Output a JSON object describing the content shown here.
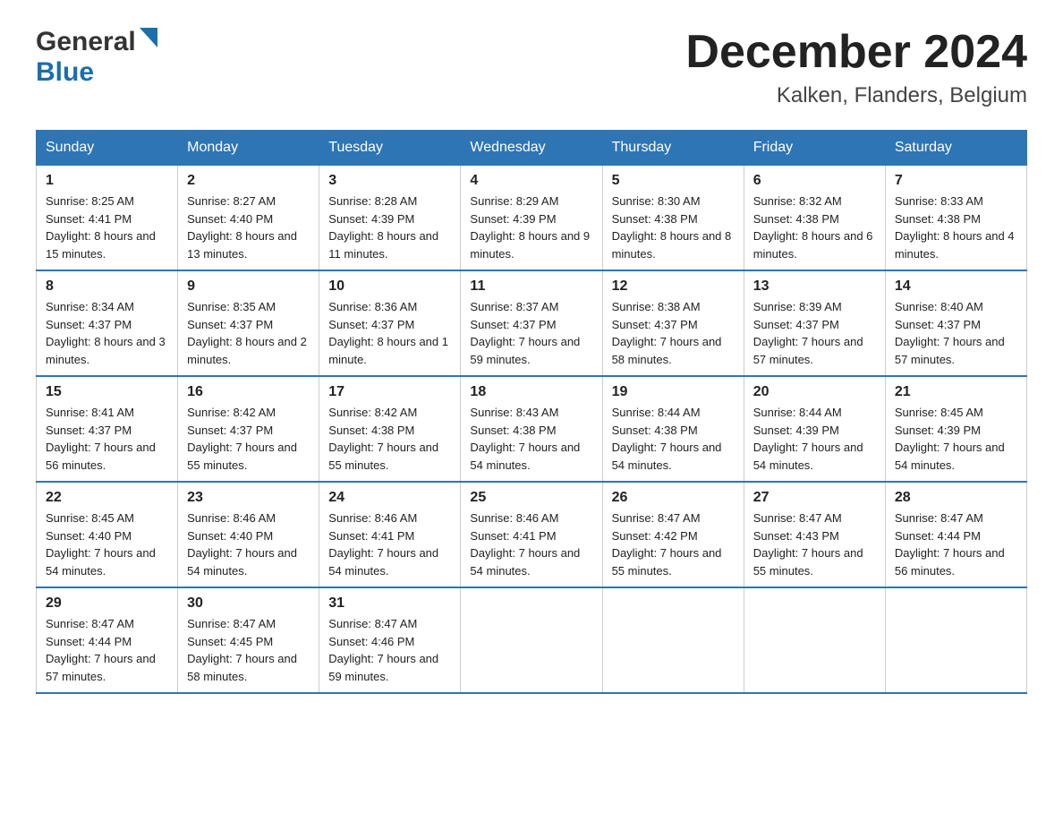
{
  "logo": {
    "general": "General",
    "blue": "Blue"
  },
  "header": {
    "month_year": "December 2024",
    "location": "Kalken, Flanders, Belgium"
  },
  "days_of_week": [
    "Sunday",
    "Monday",
    "Tuesday",
    "Wednesday",
    "Thursday",
    "Friday",
    "Saturday"
  ],
  "weeks": [
    [
      {
        "day": "1",
        "sunrise": "8:25 AM",
        "sunset": "4:41 PM",
        "daylight": "8 hours and 15 minutes."
      },
      {
        "day": "2",
        "sunrise": "8:27 AM",
        "sunset": "4:40 PM",
        "daylight": "8 hours and 13 minutes."
      },
      {
        "day": "3",
        "sunrise": "8:28 AM",
        "sunset": "4:39 PM",
        "daylight": "8 hours and 11 minutes."
      },
      {
        "day": "4",
        "sunrise": "8:29 AM",
        "sunset": "4:39 PM",
        "daylight": "8 hours and 9 minutes."
      },
      {
        "day": "5",
        "sunrise": "8:30 AM",
        "sunset": "4:38 PM",
        "daylight": "8 hours and 8 minutes."
      },
      {
        "day": "6",
        "sunrise": "8:32 AM",
        "sunset": "4:38 PM",
        "daylight": "8 hours and 6 minutes."
      },
      {
        "day": "7",
        "sunrise": "8:33 AM",
        "sunset": "4:38 PM",
        "daylight": "8 hours and 4 minutes."
      }
    ],
    [
      {
        "day": "8",
        "sunrise": "8:34 AM",
        "sunset": "4:37 PM",
        "daylight": "8 hours and 3 minutes."
      },
      {
        "day": "9",
        "sunrise": "8:35 AM",
        "sunset": "4:37 PM",
        "daylight": "8 hours and 2 minutes."
      },
      {
        "day": "10",
        "sunrise": "8:36 AM",
        "sunset": "4:37 PM",
        "daylight": "8 hours and 1 minute."
      },
      {
        "day": "11",
        "sunrise": "8:37 AM",
        "sunset": "4:37 PM",
        "daylight": "7 hours and 59 minutes."
      },
      {
        "day": "12",
        "sunrise": "8:38 AM",
        "sunset": "4:37 PM",
        "daylight": "7 hours and 58 minutes."
      },
      {
        "day": "13",
        "sunrise": "8:39 AM",
        "sunset": "4:37 PM",
        "daylight": "7 hours and 57 minutes."
      },
      {
        "day": "14",
        "sunrise": "8:40 AM",
        "sunset": "4:37 PM",
        "daylight": "7 hours and 57 minutes."
      }
    ],
    [
      {
        "day": "15",
        "sunrise": "8:41 AM",
        "sunset": "4:37 PM",
        "daylight": "7 hours and 56 minutes."
      },
      {
        "day": "16",
        "sunrise": "8:42 AM",
        "sunset": "4:37 PM",
        "daylight": "7 hours and 55 minutes."
      },
      {
        "day": "17",
        "sunrise": "8:42 AM",
        "sunset": "4:38 PM",
        "daylight": "7 hours and 55 minutes."
      },
      {
        "day": "18",
        "sunrise": "8:43 AM",
        "sunset": "4:38 PM",
        "daylight": "7 hours and 54 minutes."
      },
      {
        "day": "19",
        "sunrise": "8:44 AM",
        "sunset": "4:38 PM",
        "daylight": "7 hours and 54 minutes."
      },
      {
        "day": "20",
        "sunrise": "8:44 AM",
        "sunset": "4:39 PM",
        "daylight": "7 hours and 54 minutes."
      },
      {
        "day": "21",
        "sunrise": "8:45 AM",
        "sunset": "4:39 PM",
        "daylight": "7 hours and 54 minutes."
      }
    ],
    [
      {
        "day": "22",
        "sunrise": "8:45 AM",
        "sunset": "4:40 PM",
        "daylight": "7 hours and 54 minutes."
      },
      {
        "day": "23",
        "sunrise": "8:46 AM",
        "sunset": "4:40 PM",
        "daylight": "7 hours and 54 minutes."
      },
      {
        "day": "24",
        "sunrise": "8:46 AM",
        "sunset": "4:41 PM",
        "daylight": "7 hours and 54 minutes."
      },
      {
        "day": "25",
        "sunrise": "8:46 AM",
        "sunset": "4:41 PM",
        "daylight": "7 hours and 54 minutes."
      },
      {
        "day": "26",
        "sunrise": "8:47 AM",
        "sunset": "4:42 PM",
        "daylight": "7 hours and 55 minutes."
      },
      {
        "day": "27",
        "sunrise": "8:47 AM",
        "sunset": "4:43 PM",
        "daylight": "7 hours and 55 minutes."
      },
      {
        "day": "28",
        "sunrise": "8:47 AM",
        "sunset": "4:44 PM",
        "daylight": "7 hours and 56 minutes."
      }
    ],
    [
      {
        "day": "29",
        "sunrise": "8:47 AM",
        "sunset": "4:44 PM",
        "daylight": "7 hours and 57 minutes."
      },
      {
        "day": "30",
        "sunrise": "8:47 AM",
        "sunset": "4:45 PM",
        "daylight": "7 hours and 58 minutes."
      },
      {
        "day": "31",
        "sunrise": "8:47 AM",
        "sunset": "4:46 PM",
        "daylight": "7 hours and 59 minutes."
      },
      null,
      null,
      null,
      null
    ]
  ]
}
